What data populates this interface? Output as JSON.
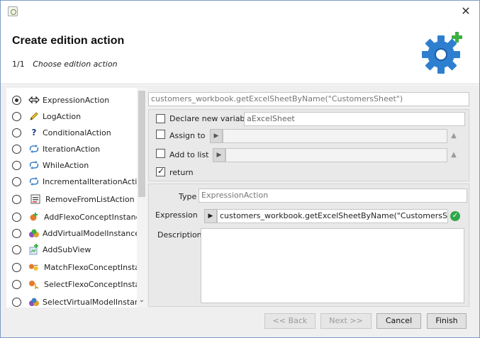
{
  "dialog": {
    "title": "Create edition action",
    "step_number": "1/1",
    "step_description": "Choose edition action"
  },
  "actions": [
    {
      "label": "ExpressionAction",
      "icon": "arrows-icon",
      "selected": true
    },
    {
      "label": "LogAction",
      "icon": "pencil-icon",
      "selected": false
    },
    {
      "label": "ConditionalAction",
      "icon": "question-icon",
      "selected": false
    },
    {
      "label": "IterationAction",
      "icon": "loop-icon",
      "selected": false
    },
    {
      "label": "WhileAction",
      "icon": "loop-icon",
      "selected": false
    },
    {
      "label": "IncrementalIterationAction",
      "icon": "loop-icon",
      "selected": false
    },
    {
      "label": "RemoveFromListAction",
      "icon": "list-remove-icon",
      "selected": false
    },
    {
      "label": "AddFlexoConceptInstance",
      "icon": "flexo-concept-add-icon",
      "selected": false
    },
    {
      "label": "AddVirtualModelInstance",
      "icon": "virtual-model-add-icon",
      "selected": false
    },
    {
      "label": "AddSubView",
      "icon": "subview-add-icon",
      "selected": false
    },
    {
      "label": "MatchFlexoConceptInstance",
      "icon": "flexo-concept-match-icon",
      "selected": false
    },
    {
      "label": "SelectFlexoConceptInstance",
      "icon": "flexo-concept-select-icon",
      "selected": false
    },
    {
      "label": "SelectVirtualModelInstance",
      "icon": "virtual-model-select-icon",
      "selected": false
    }
  ],
  "expression_summary": "customers_workbook.getExcelSheetByName(\"CustomersSheet\")",
  "declare": {
    "label": "Declare new variable",
    "value": "aExcelSheet",
    "checked": false
  },
  "assign": {
    "label": "Assign to",
    "value": "",
    "checked": false
  },
  "add_to_list": {
    "label": "Add to list",
    "value": "",
    "checked": false
  },
  "return_option": {
    "label": "return",
    "checked": true
  },
  "details": {
    "type_label": "Type",
    "type_value": "ExpressionAction",
    "expression_label": "Expression",
    "expression_value": "customers_workbook.getExcelSheetByName(\"CustomersSheet\")",
    "description_label": "Description",
    "description_value": ""
  },
  "buttons": {
    "back": "<< Back",
    "next": "Next >>",
    "cancel": "Cancel",
    "finish": "Finish"
  },
  "colors": {
    "accent": "#2f7fd1",
    "valid": "#2fa84a",
    "logo_plus": "#3cb043"
  }
}
